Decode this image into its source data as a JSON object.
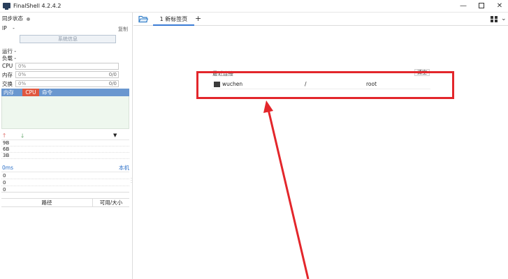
{
  "window": {
    "title": "FinalShell 4.2.4.2",
    "controls": {
      "minimize": "—",
      "maximize": "",
      "close": "✕"
    }
  },
  "sidebar": {
    "sync_label": "同步状态",
    "ip_label": "IP",
    "ip_value": "-",
    "copy_label": "复制",
    "sysinfo_button": "系统信息",
    "uptime_label": "运行",
    "uptime_value": "-",
    "load_label": "负载",
    "load_value": "-",
    "cpu": {
      "label": "CPU",
      "percent": "0%",
      "fraction": 0
    },
    "memory": {
      "label": "内存",
      "percent": "0%",
      "usage": "0/0",
      "fraction": 0
    },
    "swap": {
      "label": "交换",
      "percent": "0%",
      "usage": "0/0",
      "fraction": 0
    },
    "process_table": {
      "col_mem": "内存",
      "col_cpu": "CPU",
      "col_cmd": "命令"
    },
    "network": {
      "scale_labels": [
        "9B",
        "6B",
        "3B"
      ]
    },
    "ping": {
      "latency": "0ms",
      "host": "本机",
      "values": [
        "0",
        "0",
        "0"
      ]
    },
    "disk_table": {
      "col_path": "路径",
      "col_size": "可用/大小"
    }
  },
  "tabs": {
    "active_label": "1 新标签页",
    "add_label": "+"
  },
  "recent": {
    "title": "最近连接",
    "clear_label": "清空",
    "items": [
      {
        "name": "wuchen",
        "path": "/",
        "user": "root"
      }
    ]
  },
  "colors": {
    "accent": "#3a7bd5",
    "process_header": "#6a97cf",
    "cpu_highlight": "#e0573f",
    "annotation_red": "#e3262b",
    "ping_blue": "#2b6fc7"
  }
}
